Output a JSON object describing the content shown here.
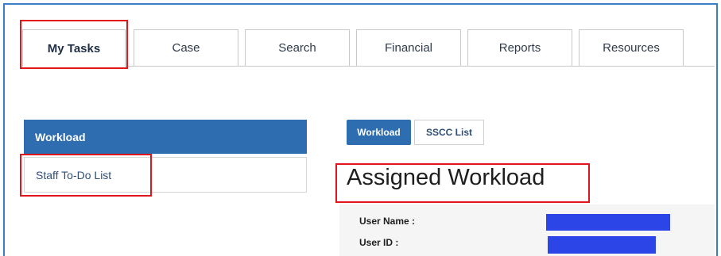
{
  "top_tabs": [
    {
      "label": "My Tasks",
      "active": true
    },
    {
      "label": "Case",
      "active": false
    },
    {
      "label": "Search",
      "active": false
    },
    {
      "label": "Financial",
      "active": false
    },
    {
      "label": "Reports",
      "active": false
    },
    {
      "label": "Resources",
      "active": false
    }
  ],
  "sidebar": {
    "items": [
      {
        "label": "Workload",
        "active": true
      },
      {
        "label": "Staff To-Do List",
        "active": false
      }
    ]
  },
  "subtabs": [
    {
      "label": "Workload",
      "active": true
    },
    {
      "label": "SSCC List",
      "active": false
    }
  ],
  "main": {
    "title": "Assigned Workload",
    "fields": [
      {
        "label": "User Name :"
      },
      {
        "label": "User ID :"
      }
    ]
  },
  "colors": {
    "accent": "#2f6db1",
    "frame": "#3a7fc6",
    "highlight": "#e0161c",
    "redaction": "#2b45e6"
  }
}
